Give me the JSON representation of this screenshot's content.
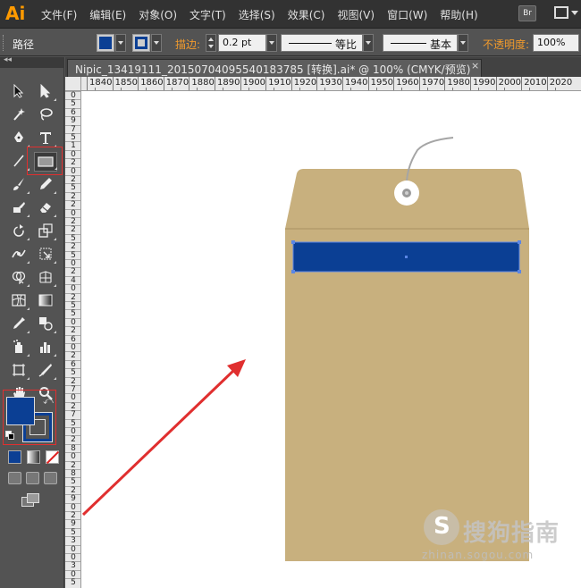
{
  "app": {
    "logo": "Ai"
  },
  "menu": [
    "文件(F)",
    "编辑(E)",
    "对象(O)",
    "文字(T)",
    "选择(S)",
    "效果(C)",
    "视图(V)",
    "窗口(W)",
    "帮助(H)"
  ],
  "menubar_right": {
    "bridge_label": "Br"
  },
  "control_bar": {
    "object_label": "路径",
    "stroke_label": "描边:",
    "stroke_value": "0.2 pt",
    "profile_label": "等比",
    "brush_label": "基本",
    "opacity_label": "不透明度:",
    "opacity_value": "100%"
  },
  "tools_header": "◂◂",
  "document": {
    "tab_title": "Nipic_13419111_20150704095540183785  [转换].ai* @ 100% (CMYK/预览)",
    "close_label": "×"
  },
  "ruler": {
    "horizontal": [
      "1840",
      "1850",
      "1860",
      "1870",
      "1880",
      "1890",
      "1900",
      "1910",
      "1920",
      "1930",
      "1940",
      "1950",
      "1960",
      "1970",
      "1980",
      "1990",
      "2000",
      "2010",
      "2020"
    ],
    "vertical": [
      "0",
      "5",
      "6",
      "9",
      "7",
      "5",
      "1",
      "0",
      "2",
      "0",
      "2",
      "5",
      "2",
      "2",
      "0",
      "2",
      "2",
      "5",
      "2",
      "5",
      "0",
      "2",
      "4",
      "0",
      "2",
      "5",
      "5",
      "0",
      "2",
      "6",
      "0",
      "2",
      "6",
      "5",
      "2",
      "7",
      "0",
      "2",
      "7",
      "5",
      "0",
      "2",
      "8",
      "0",
      "2",
      "8",
      "5",
      "2",
      "9",
      "0",
      "2",
      "9",
      "5",
      "3",
      "0",
      "0",
      "3",
      "0",
      "5"
    ]
  },
  "colors": {
    "fill": "#0b3f94",
    "stroke": "#0b3f94",
    "envelope": "#c8b07e",
    "annotation": "#e02f2f"
  },
  "watermark": {
    "brand": "搜狗指南",
    "url": "zhinan.sogou.com"
  }
}
